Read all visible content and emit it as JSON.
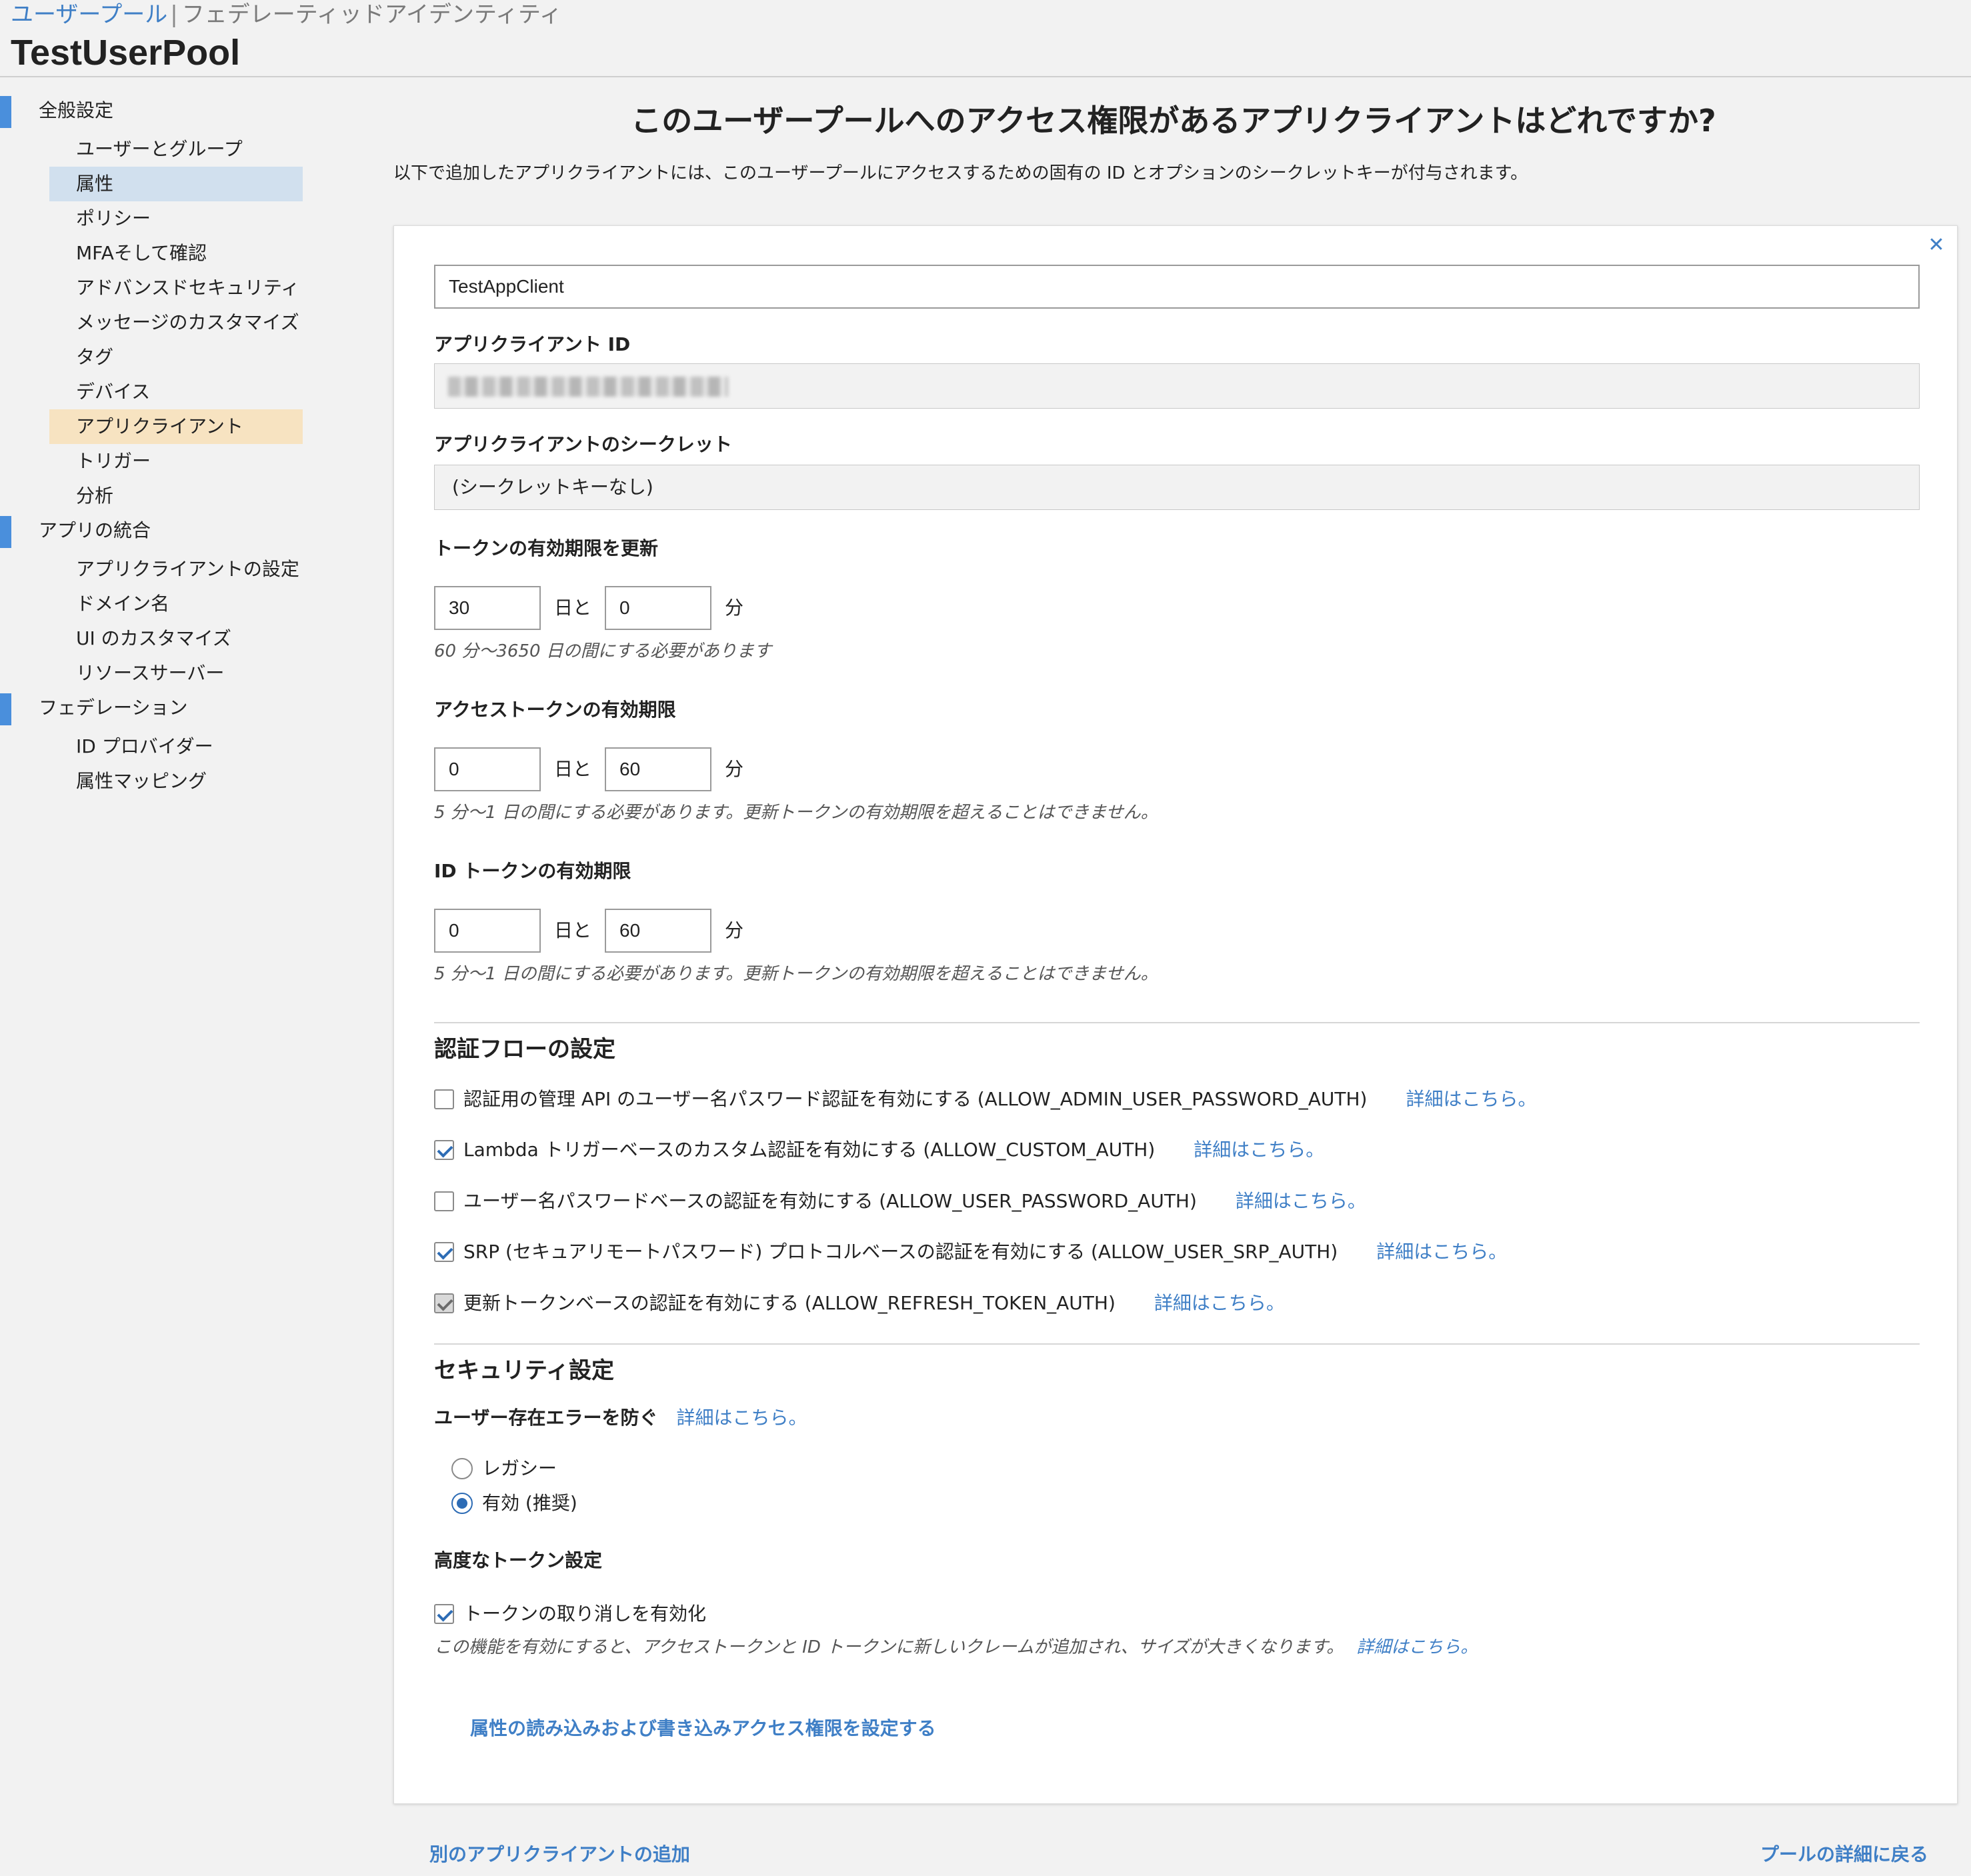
{
  "header": {
    "crumb_user_pools": "ユーザープール",
    "crumb_federated": "フェデレーティッドアイデンティティ",
    "pool_name": "TestUserPool"
  },
  "sidebar": {
    "sections": [
      {
        "label": "全般設定",
        "items": [
          "ユーザーとグループ",
          "属性",
          "ポリシー",
          "MFAそして確認",
          "アドバンスドセキュリティ",
          "メッセージのカスタマイズ",
          "タグ",
          "デバイス",
          "アプリクライアント",
          "トリガー",
          "分析"
        ]
      },
      {
        "label": "アプリの統合",
        "items": [
          "アプリクライアントの設定",
          "ドメイン名",
          "UI のカスタマイズ",
          "リソースサーバー"
        ]
      },
      {
        "label": "フェデレーション",
        "items": [
          "ID プロバイダー",
          "属性マッピング"
        ]
      }
    ]
  },
  "page": {
    "heading": "このユーザープールへのアクセス権限があるアプリクライアントはどれですか?",
    "description": "以下で追加したアプリクライアントには、このユーザープールにアクセスするための固有の ID とオプションのシークレットキーが付与されます。"
  },
  "client": {
    "name_value": "TestAppClient",
    "id_label": "アプリクライアント ID",
    "secret_label": "アプリクライアントのシークレット",
    "secret_value": "(シークレットキーなし)"
  },
  "tokens": {
    "days_unit": "日と",
    "minutes_unit": "分",
    "refresh": {
      "label": "トークンの有効期限を更新",
      "days": "30",
      "minutes": "0",
      "hint": "60 分〜3650 日の間にする必要があります"
    },
    "access": {
      "label": "アクセストークンの有効期限",
      "days": "0",
      "minutes": "60",
      "hint": "5 分〜1 日の間にする必要があります。更新トークンの有効期限を超えることはできません。"
    },
    "id": {
      "label": "ID トークンの有効期限",
      "days": "0",
      "minutes": "60",
      "hint": "5 分〜1 日の間にする必要があります。更新トークンの有効期限を超えることはできません。"
    }
  },
  "auth_flows": {
    "title": "認証フローの設定",
    "learn_more": "詳細はこちら。",
    "flows": [
      {
        "label": "認証用の管理 API のユーザー名パスワード認証を有効にする (ALLOW_ADMIN_USER_PASSWORD_AUTH)",
        "checked": false
      },
      {
        "label": "Lambda トリガーベースのカスタム認証を有効にする (ALLOW_CUSTOM_AUTH)",
        "checked": true
      },
      {
        "label": "ユーザー名パスワードベースの認証を有効にする (ALLOW_USER_PASSWORD_AUTH)",
        "checked": false
      },
      {
        "label": "SRP (セキュアリモートパスワード) プロトコルベースの認証を有効にする (ALLOW_USER_SRP_AUTH)",
        "checked": true
      },
      {
        "label": "更新トークンベースの認証を有効にする (ALLOW_REFRESH_TOKEN_AUTH)",
        "checked": true,
        "disabled": true
      }
    ]
  },
  "security": {
    "title": "セキュリティ設定",
    "prevent_label": "ユーザー存在エラーを防ぐ",
    "learn_more": "詳細はこちら。",
    "options": [
      {
        "label": "レガシー",
        "selected": false
      },
      {
        "label": "有効 (推奨)",
        "selected": true
      }
    ],
    "advanced_label": "高度なトークン設定",
    "revocation_label": "トークンの取り消しを有効化",
    "revocation_checked": true,
    "revocation_hint": "この機能を有効にすると、アクセストークンと ID トークンに新しいクレームが追加され、サイズが大きくなります。",
    "revocation_link": "詳細はこちら。",
    "attributes_link": "属性の読み込みおよび書き込みアクセス権限を設定する"
  },
  "footer": {
    "add_client": "別のアプリクライアントの追加",
    "back": "プールの詳細に戻る"
  },
  "colors": {
    "accent": "#3f7fc6",
    "sidebar_marker": "#4a8fdc",
    "selected_blue": "#d1e0ee",
    "selected_orange": "#f7e3c1"
  }
}
